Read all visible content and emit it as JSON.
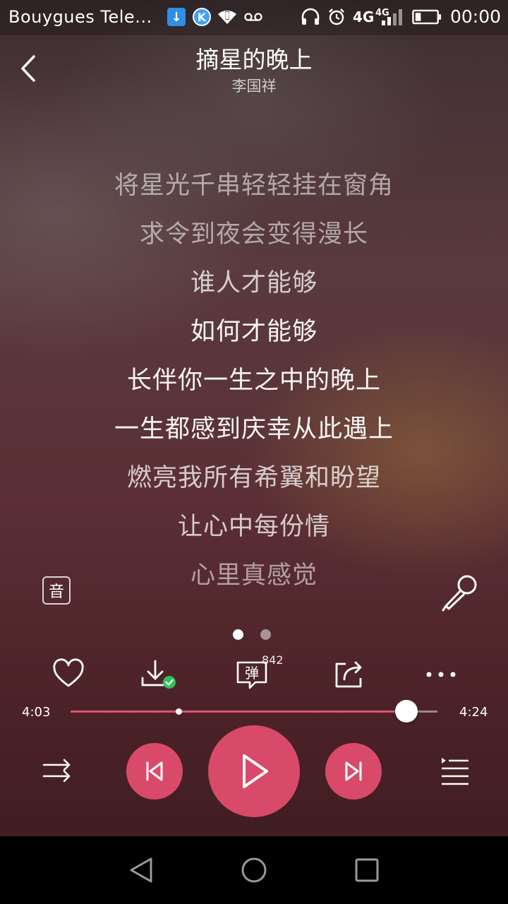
{
  "status_bar": {
    "carrier": "Bouygues Tele...",
    "network": "4G",
    "network_small": "4G",
    "time": "00:00",
    "icons": [
      "download-icon",
      "k-app-icon",
      "wifi-icon",
      "voicemail-icon",
      "headphones-icon",
      "alarm-icon",
      "signal-icon",
      "battery-icon"
    ]
  },
  "header": {
    "title": "摘星的晚上",
    "artist": "李国祥"
  },
  "lyrics": [
    "将星光千串轻轻挂在窗角",
    "求令到夜会变得漫长",
    "谁人才能够",
    "如何才能够",
    "长伴你一生之中的晚上",
    "一生都感到庆幸从此遇上",
    "燃亮我所有希翼和盼望",
    "让心中每份情",
    "心里真感觉"
  ],
  "sound_quality_label": "音",
  "actions": {
    "comment_label": "弹",
    "comment_count": "842"
  },
  "progress": {
    "current": "4:03",
    "total": "4:24",
    "played_fraction": 0.916,
    "buffer_fraction": 0.295
  },
  "colors": {
    "accent": "#d94a6a"
  }
}
